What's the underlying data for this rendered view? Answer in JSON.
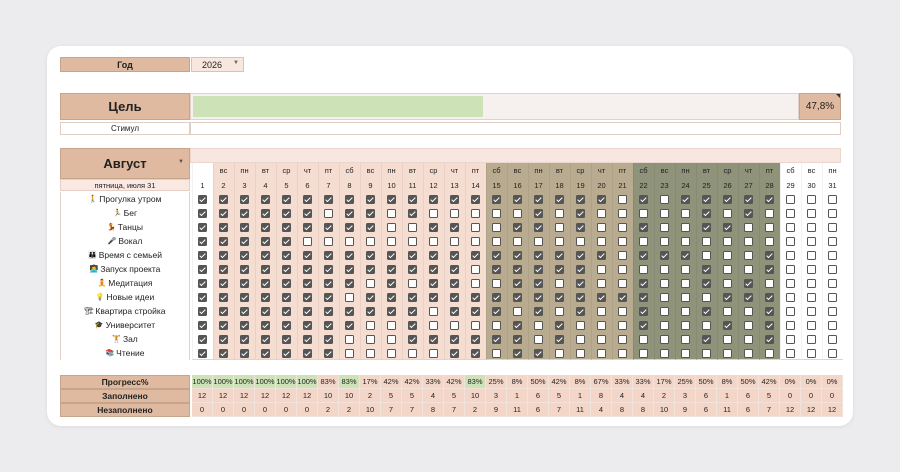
{
  "year": {
    "label": "Год",
    "value": "2026"
  },
  "goal": {
    "label": "Цель",
    "progress": 0.478,
    "percent_text": "47,8%"
  },
  "stimulus": {
    "label": "Стимул",
    "value": ""
  },
  "month": {
    "label": "Август",
    "current_date": "пятница, июля 31"
  },
  "days": [
    {
      "num": "1",
      "dow": ""
    },
    {
      "num": "2",
      "dow": "вс"
    },
    {
      "num": "3",
      "dow": "пн"
    },
    {
      "num": "4",
      "dow": "вт"
    },
    {
      "num": "5",
      "dow": "ср"
    },
    {
      "num": "6",
      "dow": "чт"
    },
    {
      "num": "7",
      "dow": "пт"
    },
    {
      "num": "8",
      "dow": "сб"
    },
    {
      "num": "9",
      "dow": "вс"
    },
    {
      "num": "10",
      "dow": "пн"
    },
    {
      "num": "11",
      "dow": "вт"
    },
    {
      "num": "12",
      "dow": "ср"
    },
    {
      "num": "13",
      "dow": "чт"
    },
    {
      "num": "14",
      "dow": "пт"
    },
    {
      "num": "15",
      "dow": "сб"
    },
    {
      "num": "16",
      "dow": "вс"
    },
    {
      "num": "17",
      "dow": "пн"
    },
    {
      "num": "18",
      "dow": "вт"
    },
    {
      "num": "19",
      "dow": "ср"
    },
    {
      "num": "20",
      "dow": "чт"
    },
    {
      "num": "21",
      "dow": "пт"
    },
    {
      "num": "22",
      "dow": "сб"
    },
    {
      "num": "23",
      "dow": "вс"
    },
    {
      "num": "24",
      "dow": "пн"
    },
    {
      "num": "25",
      "dow": "вт"
    },
    {
      "num": "26",
      "dow": "ср"
    },
    {
      "num": "27",
      "dow": "чт"
    },
    {
      "num": "28",
      "dow": "пт"
    },
    {
      "num": "29",
      "dow": "сб"
    },
    {
      "num": "30",
      "dow": "вс"
    },
    {
      "num": "31",
      "dow": "пн"
    }
  ],
  "week_colors": [
    "#ffffff",
    "#f6ddd2",
    "#b8ab8f",
    "#8e937a",
    "#ffffff"
  ],
  "habits": [
    {
      "emoji": "🚶",
      "name": "Прогулка утром",
      "checks": "1111111111111111111101011111000"
    },
    {
      "emoji": "🏃",
      "name": "Бег",
      "checks": "1111110110100000101000001010000"
    },
    {
      "emoji": "💃",
      "name": "Танцы",
      "checks": "1111111110011001101001001100000"
    },
    {
      "emoji": "🎤",
      "name": "Вокал",
      "checks": "1111100000000000000000000000000"
    },
    {
      "emoji": "👪",
      "name": "Время с семьей",
      "checks": "1111111111111111111101110001000"
    },
    {
      "emoji": "👩‍💻",
      "name": "Запуск проекта",
      "checks": "1111111111111011111000001001000"
    },
    {
      "emoji": "🧘",
      "name": "Медитация",
      "checks": "1111111101011001101001001010000"
    },
    {
      "emoji": "💡",
      "name": "Новые идеи",
      "checks": "1111111011111111111111000111000"
    },
    {
      "emoji": "🏗",
      "name": "Квартира стройка",
      "checks": "1111111111101110101001001001000"
    },
    {
      "emoji": "🎓",
      "name": "Университет",
      "checks": "1111111100100001010001000101000"
    },
    {
      "emoji": "🏋",
      "name": "Зал",
      "checks": "1111111000111111010000001001000"
    },
    {
      "emoji": "📚",
      "name": "Чтение",
      "checks": "1111111000001101100000000000000"
    }
  ],
  "footer": {
    "progress_label": "Прогресс%",
    "filled_label": "Заполнено",
    "unfilled_label": "Незаполнено",
    "progress": [
      "100%",
      "100%",
      "100%",
      "100%",
      "100%",
      "100%",
      "83%",
      "83%",
      "17%",
      "42%",
      "42%",
      "33%",
      "42%",
      "83%",
      "25%",
      "8%",
      "50%",
      "42%",
      "8%",
      "67%",
      "33%",
      "33%",
      "17%",
      "25%",
      "50%",
      "8%",
      "50%",
      "42%",
      "0%",
      "0%",
      "0%"
    ],
    "filled": [
      "12",
      "12",
      "12",
      "12",
      "12",
      "12",
      "10",
      "10",
      "2",
      "5",
      "5",
      "4",
      "5",
      "10",
      "3",
      "1",
      "6",
      "5",
      "1",
      "8",
      "4",
      "4",
      "2",
      "3",
      "6",
      "1",
      "6",
      "5",
      "0",
      "0",
      "0"
    ],
    "unfilled": [
      "0",
      "0",
      "0",
      "0",
      "0",
      "0",
      "2",
      "2",
      "10",
      "7",
      "7",
      "8",
      "7",
      "2",
      "9",
      "11",
      "6",
      "7",
      "11",
      "4",
      "8",
      "8",
      "10",
      "9",
      "6",
      "11",
      "6",
      "7",
      "12",
      "12",
      "12"
    ],
    "green": "#cde3b7",
    "salmon": "#f4d6c8"
  }
}
